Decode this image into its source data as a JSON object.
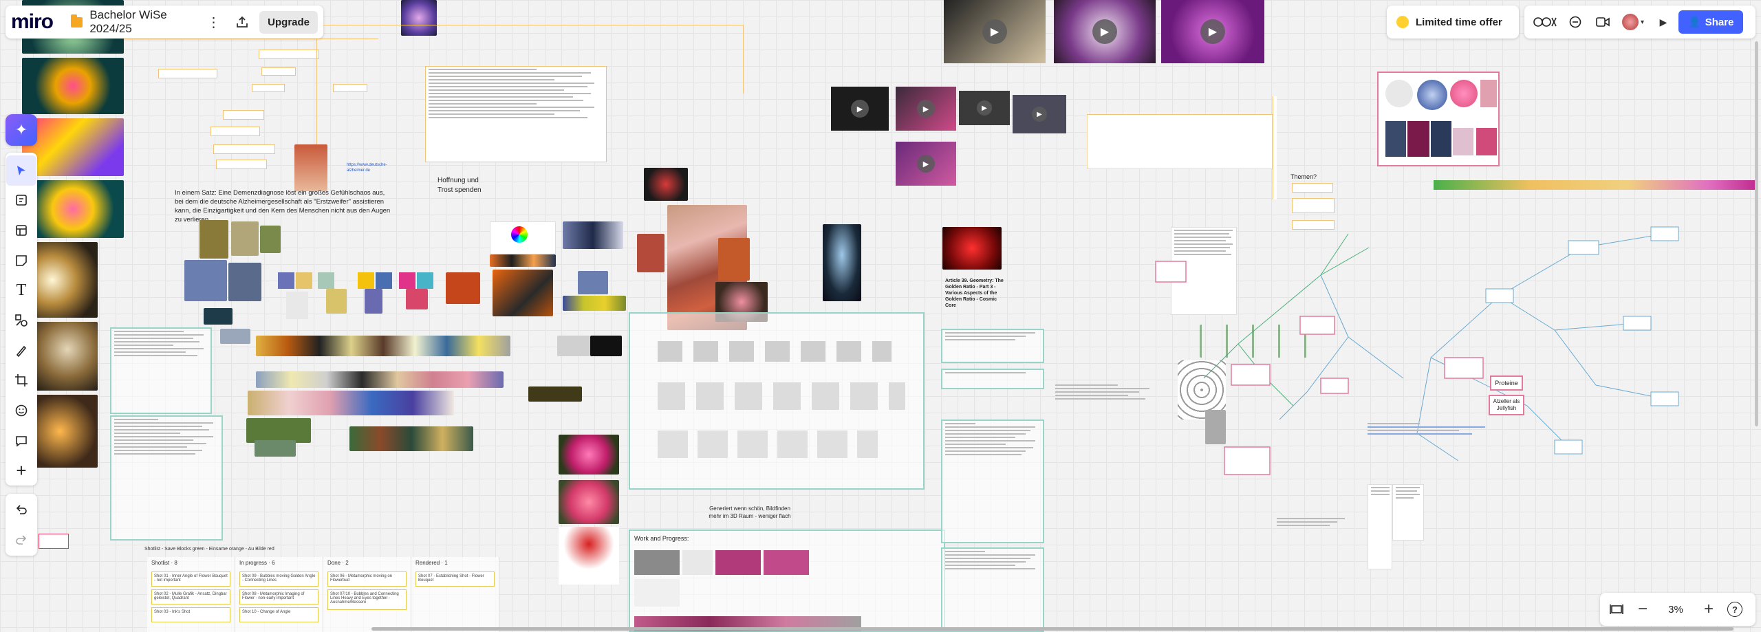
{
  "app": {
    "logo": "miro",
    "board_title": "Bachelor WiSe 2024/25",
    "more_icon": "vertical-dots-icon",
    "export_icon": "upload-icon",
    "upgrade_label": "Upgrade"
  },
  "topright": {
    "offer_label": "Limited time offer",
    "share_label": "Share",
    "icons": [
      "reactions-icon",
      "chat-icon",
      "video-icon",
      "avatar",
      "play-icon"
    ]
  },
  "toolbar": {
    "tools": [
      "ai-icon",
      "select-icon",
      "templates-icon",
      "frame-icon",
      "sticky-note-icon",
      "text-icon",
      "shapes-icon",
      "pen-icon",
      "crop-icon",
      "emoji-icon",
      "comment-icon",
      "plus-icon"
    ],
    "undo_icon": "undo-icon",
    "redo_icon": "redo-icon"
  },
  "zoom": {
    "level": "3%",
    "fit_icon": "fit-to-screen-icon",
    "minus": "−",
    "plus": "+",
    "help": "?"
  },
  "board": {
    "quote_text": "In einem Satz: Eine Demenzdiagnose löst ein großes Gefühlschaos aus, bei dem die deutsche Alzheimergesellschaft als \"Erstzweifer\" assistieren kann, die Einzigartigkeit und den Kern des Menschen nicht aus den Augen zu verlieren",
    "hope_text": "Hoffnung und\nTrost spenden",
    "generated_note": "Generiert wenn schön, Bildfinden\nmehr im 3D Raum - weniger flach",
    "work_progress": "Work and Progress:",
    "themen": "Themen?",
    "proteine": "Proteine",
    "alzheimer_jellyfish": "Alzeller als\nJellyfish",
    "article_title": "Article 39. Geometry: The Golden Ratio - Part 3 - Various Aspects of the Golden Ratio - Cosmic Core",
    "kanban_legend": "Shotlist - Save Blocks green - Einsame orange - Au Bilde red",
    "kanban": [
      {
        "title": "Shotlist · 8",
        "cards": [
          "Shot 01 - Inner Angle of Flower Bouquet - not important",
          "Shot 02 - Mulle Grafik - Ansatz, Dingbar geleistet, Quadrant",
          "Shot 03 - Ink's Shot"
        ]
      },
      {
        "title": "In progress · 6",
        "cards": [
          "Shot 09 - Bubbles moving Golden Angle - Connecting Lines",
          "Shot 08 - Metamorphic Imaging of Flower - non-early important",
          "Shot 10 - Change of Angle"
        ]
      },
      {
        "title": "Done · 2",
        "cards": [
          "Shot 06 - Metamorphic moving on Flowerbud",
          "Shot 07/10 - Bubbles and Connecting Lines Heavy and Eyes together - Ausnahme/Bessere"
        ]
      },
      {
        "title": "Rendered · 1",
        "cards": [
          "Shot 07 - Establishing Shot - Flower Bouquet"
        ]
      }
    ]
  }
}
